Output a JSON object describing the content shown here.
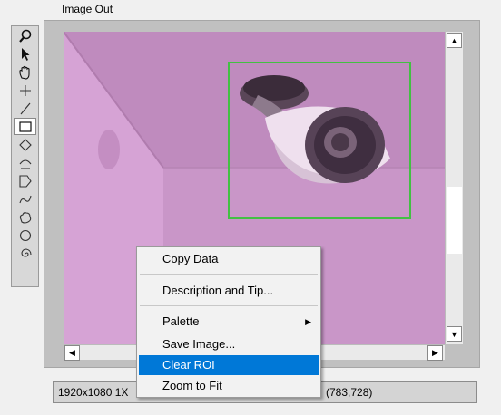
{
  "window": {
    "title": "Image Out"
  },
  "palette": {
    "tools": [
      {
        "name": "zoom-tool-icon",
        "glyph": "🔍"
      },
      {
        "name": "pointer-tool-icon",
        "glyph": "↖"
      },
      {
        "name": "pan-tool-icon",
        "glyph": "✋"
      },
      {
        "name": "point-tool-icon",
        "glyph": "┼"
      },
      {
        "name": "line-tool-icon",
        "glyph": "╱"
      },
      {
        "name": "rectangle-tool-icon",
        "glyph": "□"
      },
      {
        "name": "rotated-rectangle-tool-icon",
        "glyph": "◇"
      },
      {
        "name": "annulus-tool-icon",
        "glyph": "◠"
      },
      {
        "name": "polygon-tool-icon",
        "glyph": "⬠"
      },
      {
        "name": "freehand-line-tool-icon",
        "glyph": "∿"
      },
      {
        "name": "freehand-region-tool-icon",
        "glyph": "☁"
      },
      {
        "name": "oval-tool-icon",
        "glyph": "○"
      },
      {
        "name": "spiral-tool-icon",
        "glyph": "૯"
      }
    ],
    "selected_index": 5
  },
  "status": {
    "resolution": "1920x1080 1X",
    "coordinates": "(783,728)"
  },
  "context_menu": {
    "items": [
      {
        "label": "Copy Data"
      },
      {
        "label": "Description and Tip..."
      },
      {
        "label": "Palette",
        "submenu": true
      },
      {
        "label": "Save Image..."
      },
      {
        "label": "Clear ROI",
        "highlighted": true
      },
      {
        "label": "Zoom to Fit"
      }
    ]
  },
  "colors": {
    "roi": "#43c043",
    "highlight": "#0078d7",
    "image_tint": "#cb98c9"
  }
}
